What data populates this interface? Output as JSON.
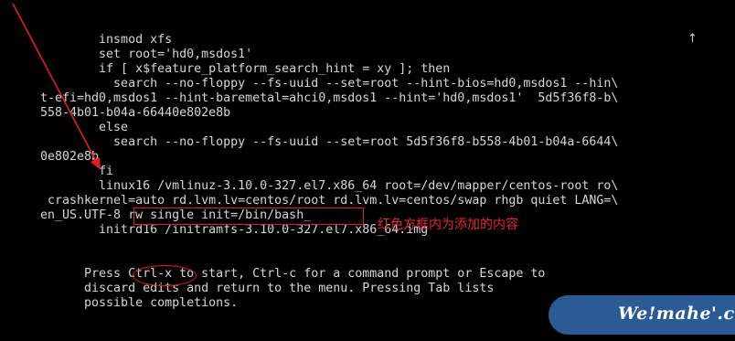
{
  "console": {
    "lines": [
      "        insmod xfs",
      "        set root='hd0,msdos1'",
      "        if [ x$feature_platform_search_hint = xy ]; then",
      "          search --no-floppy --fs-uuid --set=root --hint-bios=hd0,msdos1 --hin\\",
      "t-efi=hd0,msdos1 --hint-baremetal=ahci0,msdos1 --hint='hd0,msdos1'  5d5f36f8-b\\",
      "558-4b01-b04a-66440e802e8b",
      "        else",
      "          search --no-floppy --fs-uuid --set=root 5d5f36f8-b558-4b01-b04a-6644\\",
      "0e802e8b",
      "        fi",
      "        linux16 /vmlinuz-3.10.0-327.el7.x86_64 root=/dev/mapper/centos-root ro\\",
      " crashkernel=auto rd.lvm.lv=centos/root rd.lvm.lv=centos/swap rhgb quiet LANG=\\",
      "en_US.UTF-8 rw single init=/bin/bash_",
      "        initrd16 /initramfs-3.10.0-327.el7.x86_64.img",
      "",
      "",
      "      Press Ctrl-x to start, Ctrl-c for a command prompt or Escape to",
      "      discard edits and return to the menu. Pressing Tab lists",
      "      possible completions."
    ],
    "scroll_indicator": "↑"
  },
  "annotation": {
    "text": "红色方框内为添加的内容",
    "color": "#e52a2a"
  },
  "watermark": {
    "text": "We!mahe'.com",
    "bg_color": "#2b5b94"
  },
  "colors": {
    "text": "#d6d6d6",
    "background": "#000000",
    "highlight": "#e02020"
  }
}
